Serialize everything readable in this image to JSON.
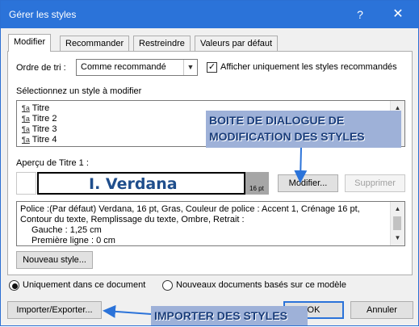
{
  "window": {
    "title": "Gérer les styles",
    "help": "?",
    "close": "✕"
  },
  "tabs": [
    {
      "label": "Modifier"
    },
    {
      "label": "Recommander"
    },
    {
      "label": "Restreindre"
    },
    {
      "label": "Valeurs par défaut"
    }
  ],
  "sort": {
    "label": "Ordre de tri :",
    "value": "Comme recommandé"
  },
  "recommended_only": {
    "label": "Afficher uniquement les styles recommandés",
    "checked": true
  },
  "styles_list": {
    "label": "Sélectionnez un style à modifier",
    "items": [
      "Titre",
      "Titre 2",
      "Titre 3",
      "Titre 4"
    ],
    "icon": "¶a"
  },
  "preview": {
    "label": "Aperçu de Titre 1 :",
    "sample_text": "I.  Verdana",
    "size_badge": "16 pt",
    "modify_button": "Modifier...",
    "delete_button": "Supprimer"
  },
  "description": {
    "lines": [
      "Police :(Par défaut) Verdana, 16 pt, Gras, Couleur de police : Accent 1, Crénage 16 pt,",
      "Contour du texte, Remplissage du texte, Ombre, Retrait :",
      "Gauche :  1,25 cm",
      "Première ligne : 0 cm"
    ]
  },
  "new_style_button": "Nouveau style...",
  "scope": {
    "doc_only": "Uniquement dans ce document",
    "new_docs": "Nouveaux documents basés sur ce modèle",
    "selected": "doc_only"
  },
  "footer": {
    "import_export": "Importer/Exporter...",
    "ok": "OK",
    "cancel": "Annuler"
  },
  "annotations": {
    "callout_1_line1": "BOITE DE DIALOGUE DE",
    "callout_1_line2": "MODIFICATION DES STYLES",
    "callout_2": "IMPORTER DES STYLES",
    "color": "#9eb1d8"
  },
  "colors": {
    "titlebar": "#2b73d9",
    "accent_border": "#2b73d9",
    "sample_text": "#1f4e8c"
  }
}
